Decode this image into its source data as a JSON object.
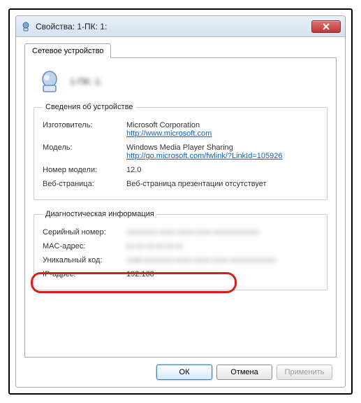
{
  "window": {
    "title": "Свойства: 1-ПК: 1:"
  },
  "tab": {
    "label": "Сетевое устройство"
  },
  "device": {
    "name": "1-ПК: 1:"
  },
  "info": {
    "legend": "Сведения об устройстве",
    "manufacturer_label": "Изготовитель:",
    "manufacturer_value": "Microsoft Corporation",
    "manufacturer_link": "http://www.microsoft.com",
    "model_label": "Модель:",
    "model_value": "Windows Media Player Sharing",
    "model_link": "http://go.microsoft.com/fwlink/?LinkId=105926",
    "model_number_label": "Номер модели:",
    "model_number_value": "12.0",
    "webpage_label": "Веб-страница:",
    "webpage_value": "Веб-страница презентации отсутствует"
  },
  "diag": {
    "legend": "Диагностическая информация",
    "serial_label": "Серийный номер:",
    "serial_value": "xxxxxxxx-xxxx-xxxx-xxxx-xxxxxxxxxxxx",
    "mac_label": "MAC-адрес:",
    "mac_value": "xx:xx:xx:xx:xx:xx",
    "unique_label": "Уникальный код:",
    "unique_value": "uuid:xxxxxxxx-xxxx-xxxx-xxxx-xxxxxxxxxxxx",
    "ip_label": "IP-адрес:",
    "ip_value": "192.168"
  },
  "buttons": {
    "ok": "ОК",
    "cancel": "Отмена",
    "apply": "Применить"
  }
}
